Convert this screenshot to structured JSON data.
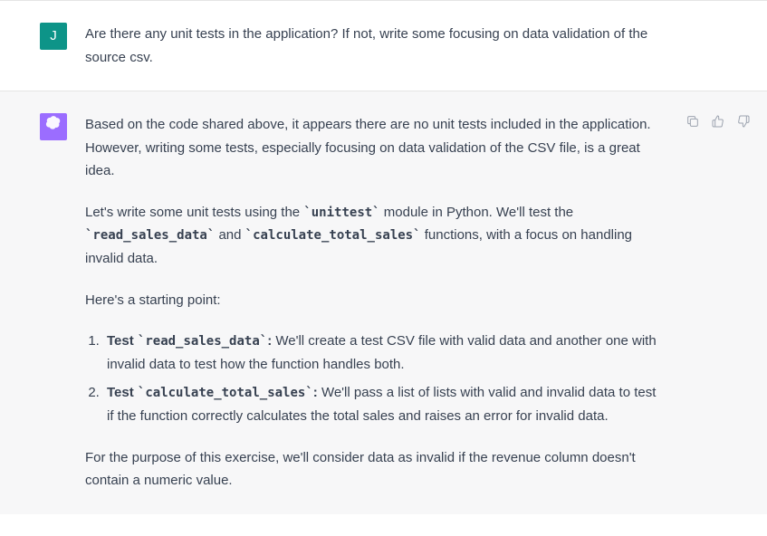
{
  "user": {
    "avatar_letter": "J",
    "message": "Are there any unit tests in the application?  If not, write some focusing on data validation of the source csv."
  },
  "assistant": {
    "intro": "Based on the code shared above, it appears there are no unit tests included in the application. However, writing some tests, especially focusing on data validation of the CSV file, is a great idea.",
    "para2_pre": "Let's write some unit tests using the ",
    "code_unittest": "`unittest`",
    "para2_mid": " module in Python. We'll test the ",
    "code_read": "`read_sales_data`",
    "para2_and": " and ",
    "code_calc": "`calculate_total_sales`",
    "para2_post": " functions, with a focus on handling invalid data.",
    "para3": "Here's a starting point:",
    "list": [
      {
        "label_pre": "Test ",
        "label_code": "`read_sales_data`",
        "label_post": ":",
        "body": " We'll create a test CSV file with valid data and another one with invalid data to test how the function handles both."
      },
      {
        "label_pre": "Test ",
        "label_code": "`calculate_total_sales`",
        "label_post": ":",
        "body": " We'll pass a list of lists with valid and invalid data to test if the function correctly calculates the total sales and raises an error for invalid data."
      }
    ],
    "para4": "For the purpose of this exercise, we'll consider data as invalid if the revenue column doesn't contain a numeric value."
  }
}
